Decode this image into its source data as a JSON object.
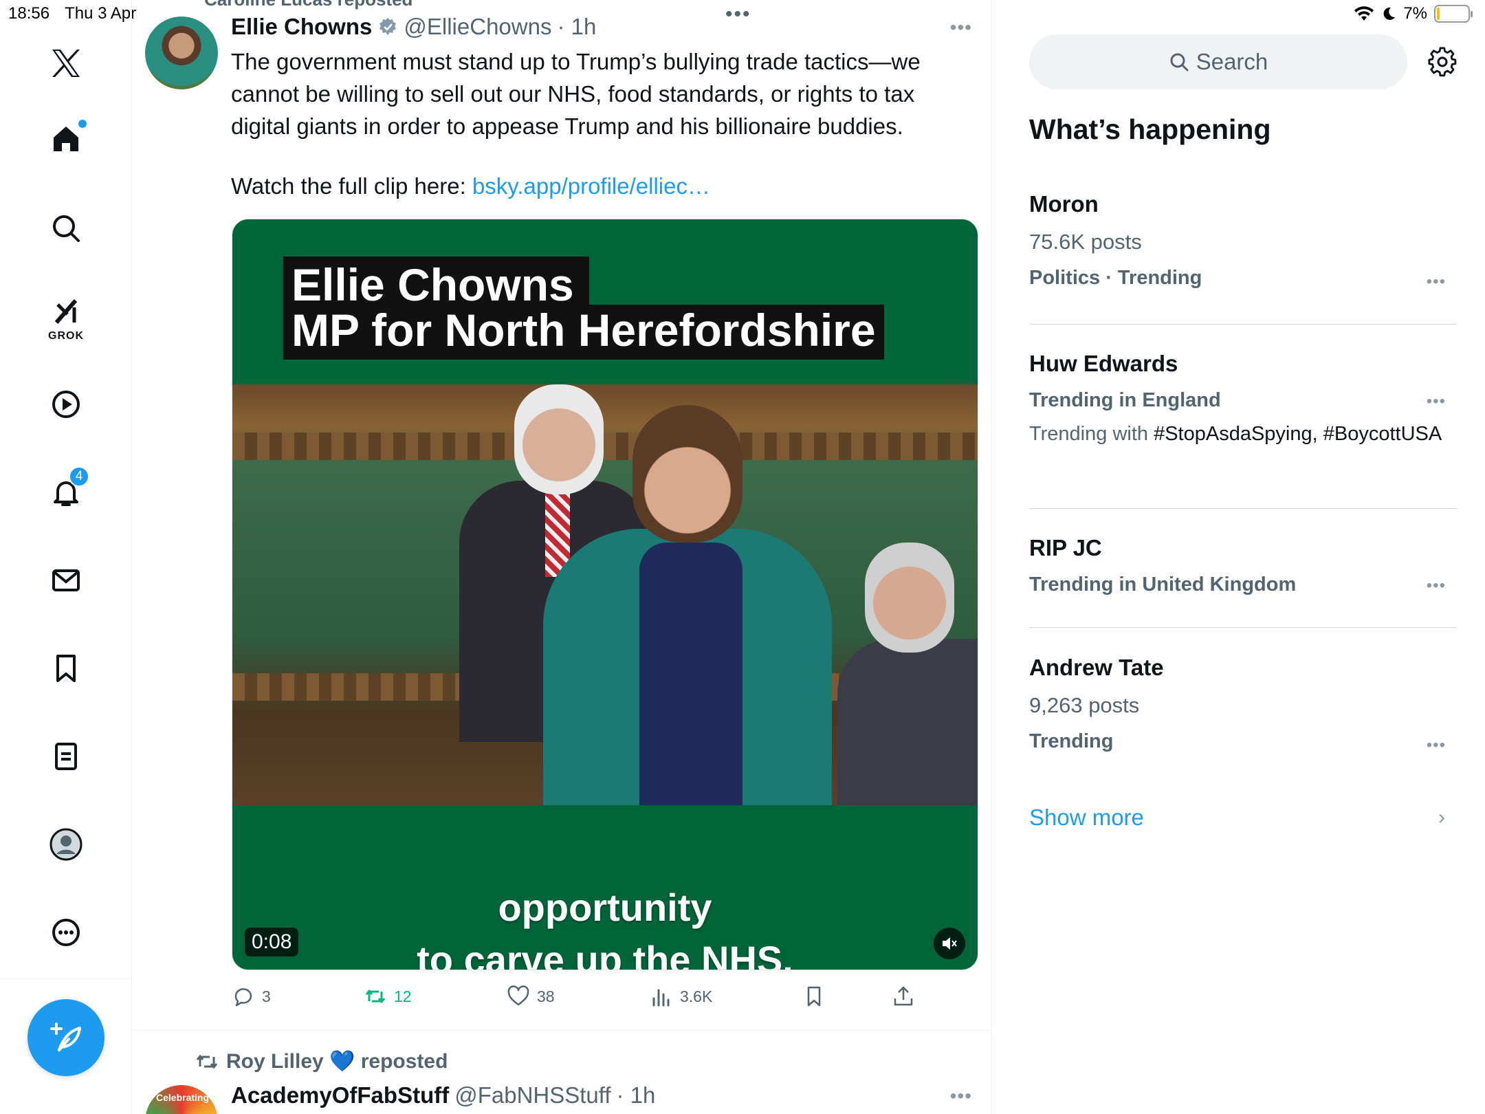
{
  "status_bar": {
    "time": "18:56",
    "date": "Thu 3 Apr",
    "battery": "7%",
    "battery_level": 0.07
  },
  "nav": {
    "grok_label": "GROK",
    "notifications_badge": "4"
  },
  "feed": {
    "top_repost_clip": "Caroline Lucas reposted",
    "tweet": {
      "name": "Ellie Chowns",
      "handle": "@EllieChowns",
      "time": "· 1h",
      "text": "The government must stand up to Trump’s bullying trade tactics—we cannot be willing to sell out our NHS, food standards, or rights to tax digital giants in order to appease Trump and his billionaire buddies.",
      "link_prefix": "Watch the full clip here: ",
      "link_text": "bsky.app/profile/elliec…",
      "media": {
        "title_line1": "Ellie Chowns",
        "title_line2": "MP for North Herefordshire",
        "caption_line1": "opportunity",
        "caption_line2": "to carve up the NHS.",
        "timestamp": "0:08"
      },
      "stats": {
        "replies": "3",
        "reposts": "12",
        "likes": "38",
        "views": "3.6K"
      }
    },
    "next_tweet": {
      "reposted_by": "Roy Lilley 💙 reposted",
      "avatar_text": "Celebrating",
      "name": "AcademyOfFabStuff",
      "handle": "@FabNHSStuff",
      "time": "· 1h"
    }
  },
  "sidebar": {
    "search_placeholder": "Search",
    "title": "What’s happening",
    "trends": [
      {
        "name": "Moron",
        "meta": "75.6K posts",
        "category": "Politics · Trending"
      },
      {
        "name": "Huw Edwards",
        "category": "Trending in England",
        "with_prefix": "Trending with ",
        "with_tags": "#StopAsdaSpying, #BoycottUSA"
      },
      {
        "name": "RIP JC",
        "category": "Trending in United Kingdom"
      },
      {
        "name": "Andrew Tate",
        "meta": "9,263 posts",
        "category": "Trending"
      }
    ],
    "show_more": "Show more"
  }
}
